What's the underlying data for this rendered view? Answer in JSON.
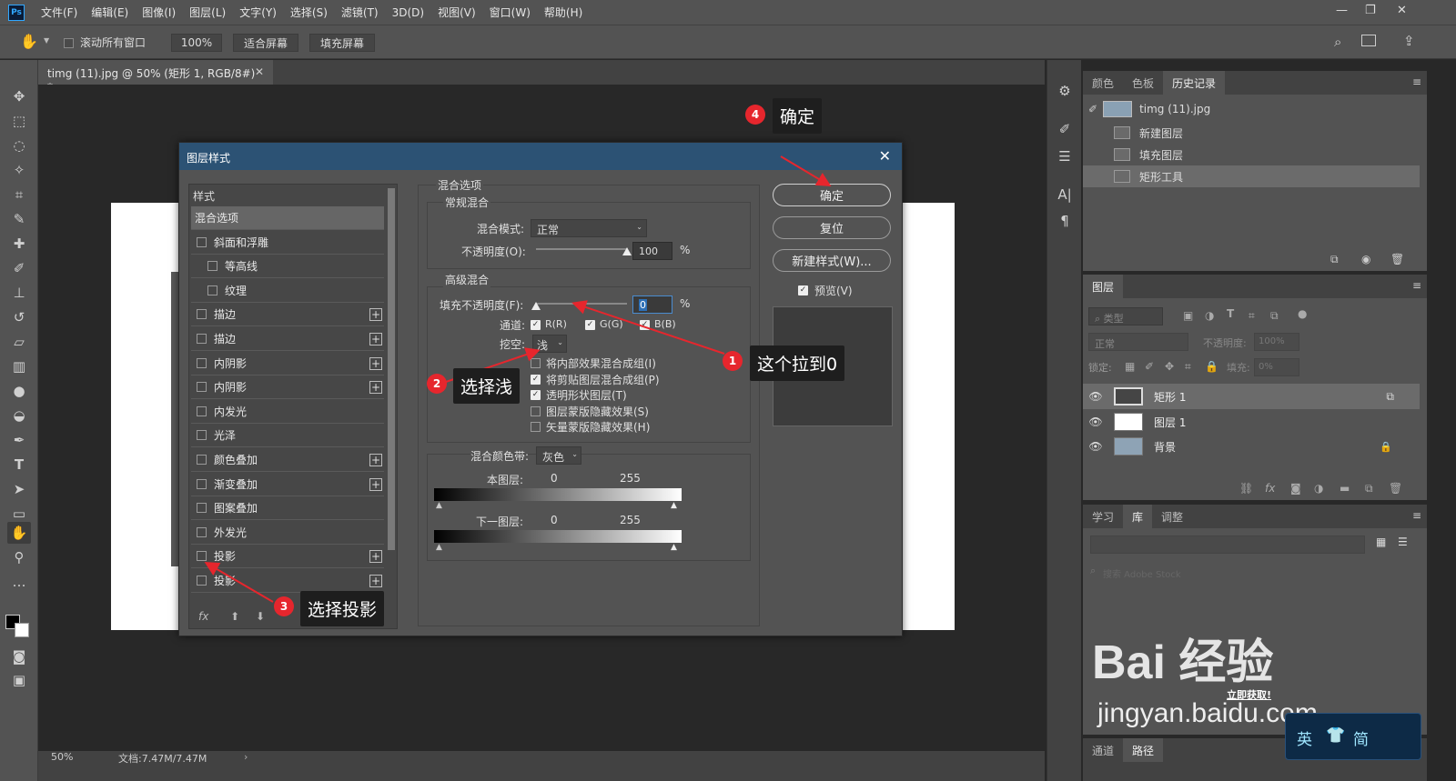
{
  "menubar": {
    "logo": "Ps",
    "items": [
      "文件(F)",
      "编辑(E)",
      "图像(I)",
      "图层(L)",
      "文字(Y)",
      "选择(S)",
      "滤镜(T)",
      "3D(D)",
      "视图(V)",
      "窗口(W)",
      "帮助(H)"
    ]
  },
  "options": {
    "scroll_all": "滚动所有窗口",
    "zoom": "100%",
    "fit_screen": "适合屏幕",
    "fill_screen": "填充屏幕"
  },
  "document": {
    "tab_title": "timg (11).jpg @ 50% (矩形 1, RGB/8#) *",
    "status_zoom": "50%",
    "status_doc": "文档:7.47M/7.47M"
  },
  "history_panel": {
    "tabs": [
      "颜色",
      "色板",
      "历史记录"
    ],
    "snapshot": "timg (11).jpg",
    "items": [
      "新建图层",
      "填充图层",
      "矩形工具"
    ]
  },
  "layers_panel": {
    "tab": "图层",
    "filter_placeholder": "类型",
    "blend_mode": "正常",
    "opacity_label": "不透明度:",
    "opacity_value": "100%",
    "lock_label": "锁定:",
    "fill_label": "填充:",
    "fill_value": "0%",
    "layers": [
      "矩形 1",
      "图层 1",
      "背景"
    ]
  },
  "library_panel": {
    "tabs": [
      "学习",
      "库",
      "调整"
    ],
    "search_placeholder": "搜索 Adobe Stock",
    "promo_link": "立即获取!"
  },
  "bottom_panel": {
    "tabs": [
      "通道",
      "路径"
    ]
  },
  "ime": {
    "lang": "英",
    "mode": "简"
  },
  "watermark": {
    "brand": "Bai 经验",
    "url": "jingyan.baidu.com"
  },
  "dialog": {
    "title": "图层样式",
    "styles_header": "样式",
    "styles": [
      {
        "label": "混合选项",
        "selected": true,
        "check": false,
        "plus": false,
        "indent": false
      },
      {
        "label": "斜面和浮雕",
        "check": true,
        "plus": false,
        "indent": false
      },
      {
        "label": "等高线",
        "check": true,
        "plus": false,
        "indent": true
      },
      {
        "label": "纹理",
        "check": true,
        "plus": false,
        "indent": true
      },
      {
        "label": "描边",
        "check": true,
        "plus": true,
        "indent": false
      },
      {
        "label": "描边",
        "check": true,
        "plus": true,
        "indent": false
      },
      {
        "label": "内阴影",
        "check": true,
        "plus": true,
        "indent": false
      },
      {
        "label": "内阴影",
        "check": true,
        "plus": true,
        "indent": false
      },
      {
        "label": "内发光",
        "check": true,
        "plus": false,
        "indent": false
      },
      {
        "label": "光泽",
        "check": true,
        "plus": false,
        "indent": false
      },
      {
        "label": "颜色叠加",
        "check": true,
        "plus": true,
        "indent": false
      },
      {
        "label": "渐变叠加",
        "check": true,
        "plus": true,
        "indent": false
      },
      {
        "label": "图案叠加",
        "check": true,
        "plus": false,
        "indent": false
      },
      {
        "label": "外发光",
        "check": true,
        "plus": false,
        "indent": false
      },
      {
        "label": "投影",
        "check": true,
        "plus": true,
        "indent": false
      },
      {
        "label": "投影",
        "check": true,
        "plus": true,
        "indent": false
      }
    ],
    "blend_options": "混合选项",
    "general_blending": "常规混合",
    "blend_mode_label": "混合模式:",
    "blend_mode_value": "正常",
    "opacity_label": "不透明度(O):",
    "opacity_value": "100",
    "opacity_level": 1.0,
    "percent": "%",
    "advanced_blending": "高级混合",
    "fill_opacity_label": "填充不透明度(F):",
    "fill_opacity_value": "0",
    "fill_opacity_level": 0,
    "channels_label": "通道:",
    "channels": [
      "R(R)",
      "G(G)",
      "B(B)"
    ],
    "knockout_label": "挖空:",
    "knockout_value": "浅",
    "options": [
      {
        "label": "将内部效果混合成组(I)",
        "checked": false
      },
      {
        "label": "将剪贴图层混合成组(P)",
        "checked": true
      },
      {
        "label": "透明形状图层(T)",
        "checked": true
      },
      {
        "label": "图层蒙版隐藏效果(S)",
        "checked": false
      },
      {
        "label": "矢量蒙版隐藏效果(H)",
        "checked": false
      }
    ],
    "blend_if_label": "混合颜色带:",
    "blend_if_value": "灰色",
    "this_layer_label": "本图层:",
    "underlying_label": "下一图层:",
    "range_min": "0",
    "range_max": "255",
    "ok": "确定",
    "reset": "复位",
    "new_style": "新建样式(W)...",
    "preview": "预览(V)"
  },
  "annotations": [
    {
      "num": "1",
      "text": "这个拉到0"
    },
    {
      "num": "2",
      "text": "选择浅"
    },
    {
      "num": "3",
      "text": "选择投影"
    },
    {
      "num": "4",
      "text": "确定"
    }
  ],
  "colors": {
    "accent_red": "#e6262d",
    "dialog_title_bg": "#2c5274"
  }
}
